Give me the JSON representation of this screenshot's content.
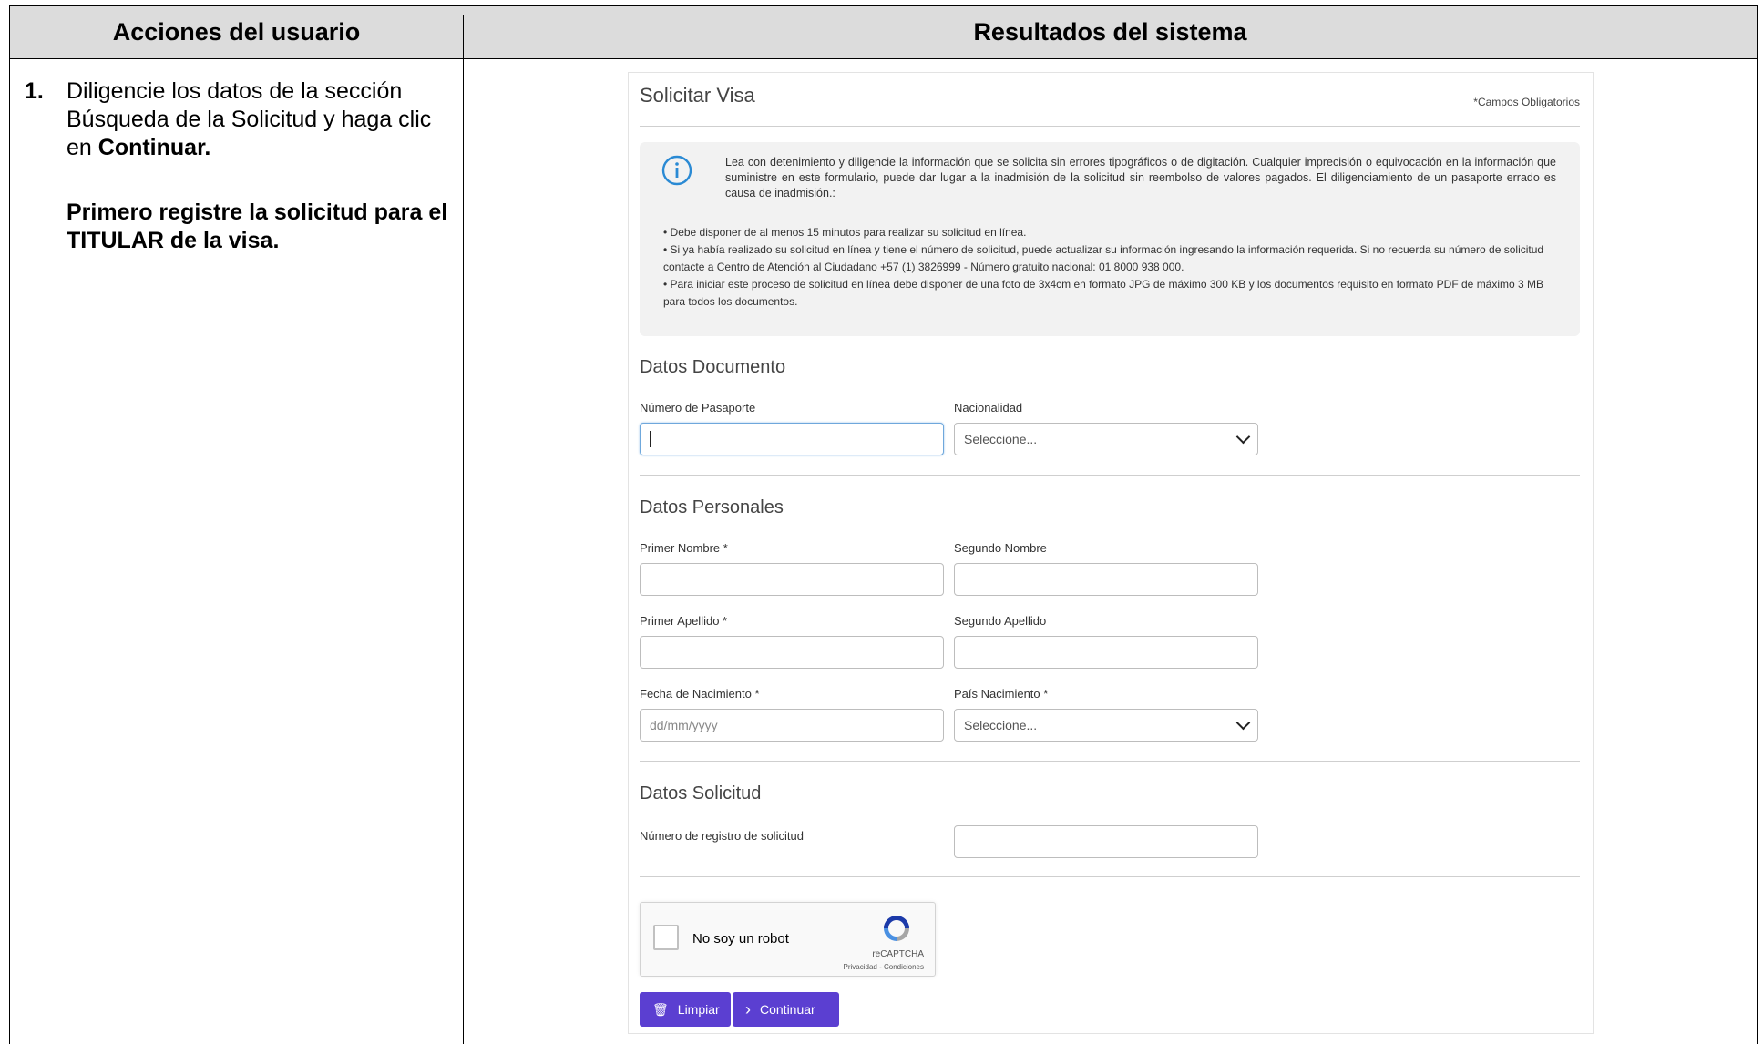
{
  "table": {
    "col_left_header": "Acciones del usuario",
    "col_right_header": "Resultados del sistema",
    "step_number": "1.",
    "step_text_plain": "Diligencie los datos de la sección Búsqueda de la Solicitud y haga clic en",
    "step_text_bold": "Continuar.",
    "note": "Primero registre la solicitud para el TITULAR de la visa."
  },
  "form": {
    "title": "Solicitar Visa",
    "required_note": "*Campos Obligatorios",
    "info": {
      "main": "Lea con detenimiento y diligencie la información que se solicita sin errores tipográficos o de digitación. Cualquier imprecisión o equivocación en la información que suministre en este formulario, puede dar lugar a la inadmisión de la solicitud sin reembolso de valores pagados. El diligenciamiento de un pasaporte errado es causa de inadmisión.:",
      "bullet1": "• Debe disponer de al menos 15 minutos para realizar su solicitud en línea.",
      "bullet2": "• Si ya había realizado su solicitud en línea y tiene el número de solicitud, puede actualizar su información ingresando la información requerida. Si no recuerda su número de solicitud contacte a Centro de Atención al Ciudadano +57 (1) 3826999 - Número gratuito nacional: 01 8000 938 000.",
      "bullet3": "• Para iniciar este proceso de solicitud en línea debe disponer de una foto de 3x4cm en formato JPG de máximo 300 KB y los documentos requisito en formato PDF de máximo 3 MB para todos los documentos."
    },
    "sections": {
      "documento": "Datos Documento",
      "personales": "Datos Personales",
      "solicitud": "Datos Solicitud"
    },
    "fields": {
      "pasaporte_label": "Número de Pasaporte",
      "pasaporte_value": "",
      "nacionalidad_label": "Nacionalidad",
      "nacionalidad_value": "Seleccione...",
      "primer_nombre_label": "Primer Nombre *",
      "segundo_nombre_label": "Segundo Nombre",
      "primer_apellido_label": "Primer Apellido *",
      "segundo_apellido_label": "Segundo Apellido",
      "fecha_label": "Fecha de Nacimiento *",
      "fecha_placeholder": "dd/mm/yyyy",
      "pais_label": "País Nacimiento *",
      "pais_value": "Seleccione...",
      "registro_label": "Número de registro de solicitud"
    },
    "captcha": {
      "text": "No soy un robot",
      "brand": "reCAPTCHA",
      "links": "Privacidad - Condiciones"
    },
    "buttons": {
      "clear": "Limpiar",
      "continue": "Continuar"
    },
    "colors": {
      "button": "#5b3fd1",
      "info_icon": "#2a8ad4"
    }
  }
}
